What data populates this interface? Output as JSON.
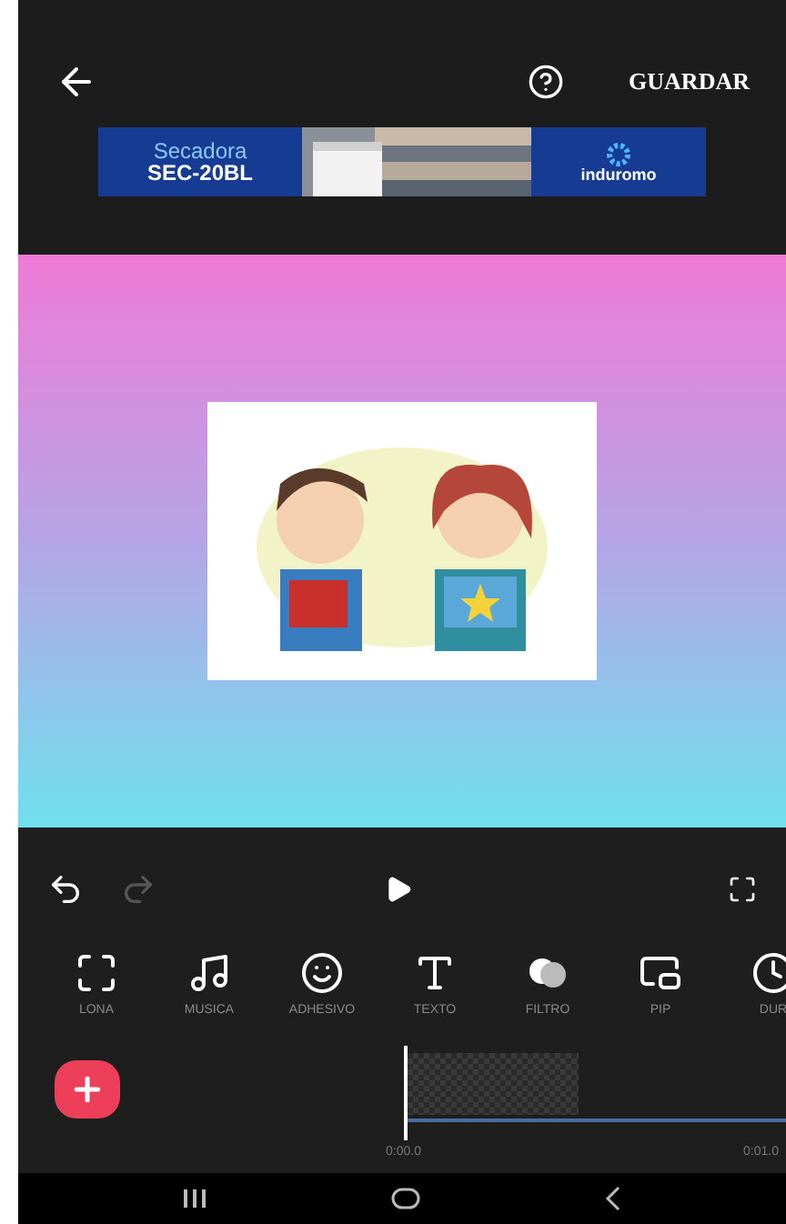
{
  "top_bar": {
    "save_label": "GUARDAR"
  },
  "ad_banner": {
    "line_1": "Secadora",
    "line_2": "SEC-20BL",
    "brand": "induromo"
  },
  "tools": [
    {
      "label": "LONA",
      "kind": "frame"
    },
    {
      "label": "MUSICA",
      "kind": "music"
    },
    {
      "label": "ADHESIVO",
      "kind": "smile"
    },
    {
      "label": "TEXTO",
      "kind": "text"
    },
    {
      "label": "FILTRO",
      "kind": "filter"
    },
    {
      "label": "PIP",
      "kind": "pip"
    },
    {
      "label": "DUR",
      "kind": "duration"
    }
  ],
  "timeline": {
    "times": [
      "0:00.0",
      "0:01.0"
    ]
  }
}
